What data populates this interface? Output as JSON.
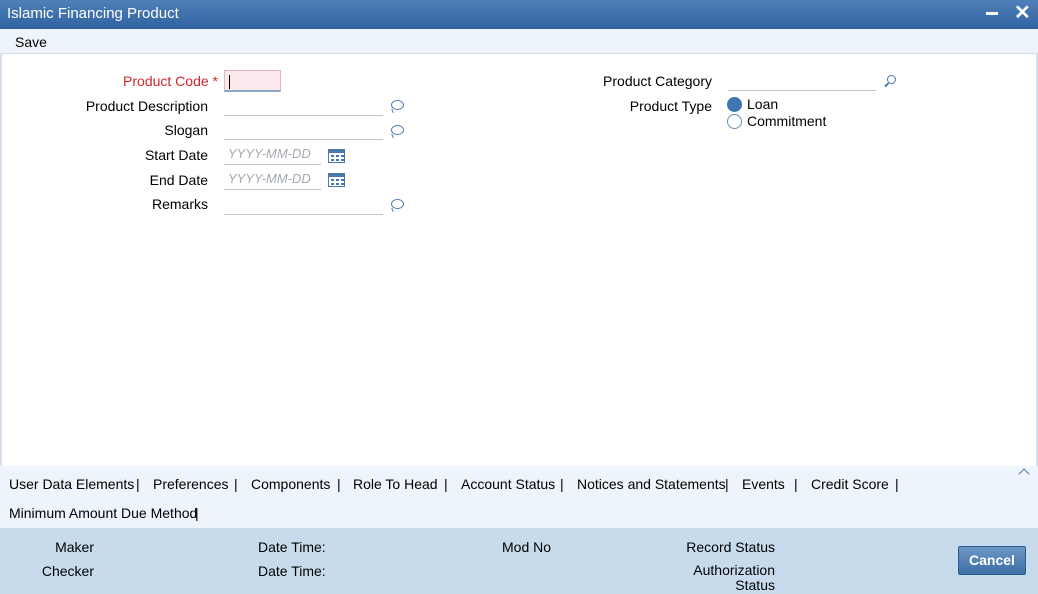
{
  "window": {
    "title": "Islamic Financing Product",
    "minimize_icon": "minimize-icon",
    "close_icon": "close-icon"
  },
  "toolbar": {
    "save_label": "Save"
  },
  "form": {
    "product_code": {
      "label": "Product Code",
      "required_marker": "*",
      "value": ""
    },
    "product_description": {
      "label": "Product Description",
      "value": ""
    },
    "slogan": {
      "label": "Slogan",
      "value": ""
    },
    "start_date": {
      "label": "Start Date",
      "placeholder": "YYYY-MM-DD"
    },
    "end_date": {
      "label": "End Date",
      "placeholder": "YYYY-MM-DD"
    },
    "remarks": {
      "label": "Remarks",
      "value": ""
    },
    "product_category": {
      "label": "Product Category",
      "value": ""
    },
    "product_type": {
      "label": "Product Type",
      "options": [
        {
          "label": "Loan",
          "selected": true
        },
        {
          "label": "Commitment",
          "selected": false
        }
      ]
    }
  },
  "tabs": {
    "items": [
      "User Data Elements",
      "Preferences",
      "Components",
      "Role To Head",
      "Account Status",
      "Notices and Statements",
      "Events",
      "Credit Score",
      "Minimum Amount Due Method"
    ],
    "separator": "|"
  },
  "footer": {
    "maker": "Maker",
    "checker": "Checker",
    "date_time_1": "Date Time:",
    "date_time_2": "Date Time:",
    "mod_no": "Mod No",
    "record_status": "Record Status",
    "authorization_status": "Authorization Status",
    "cancel_label": "Cancel"
  },
  "colors": {
    "title_bar": "#3c6ba8",
    "required": "#d1262b",
    "footer_bg": "#c7dbed",
    "tab_bg": "#eef4fb"
  }
}
